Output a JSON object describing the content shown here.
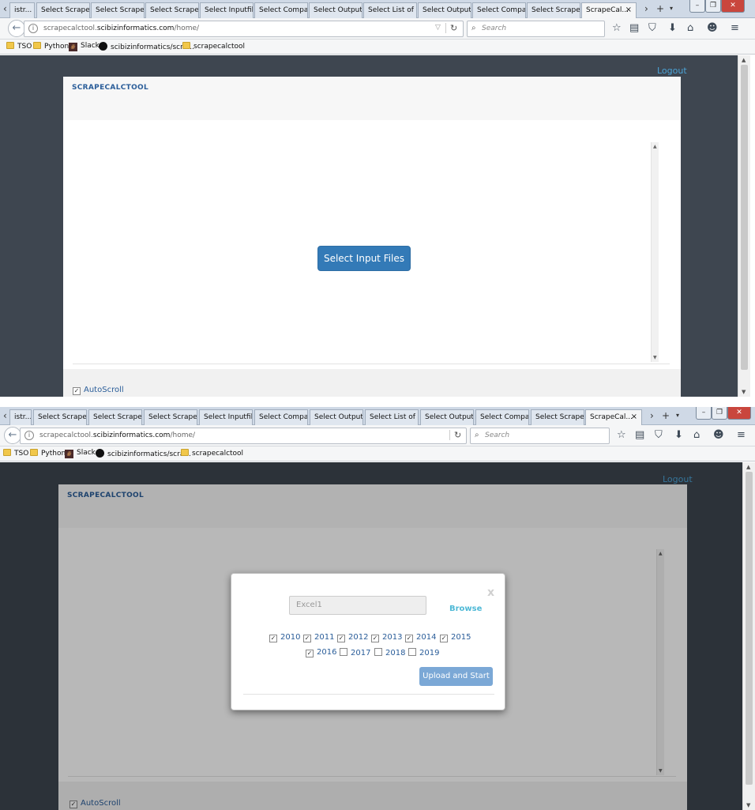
{
  "browser": {
    "tabs": [
      "istr...",
      "Select Scraper...",
      "Select Scraper...",
      "Select Scraper...",
      "Select Inputfil...",
      "Select Compa...",
      "Select Output...",
      "Select List of ...",
      "Select Output...",
      "Select Compa...",
      "Select Scraper...",
      "ScrapeCal..."
    ],
    "active_tab_close": "×",
    "new_tab": "+",
    "url_host_prefix": "scrapecalctool.",
    "url_host_bold": "scibizinformatics.com",
    "url_path": "/home/",
    "search_placeholder": "Search",
    "bookmarks": [
      "TSO",
      "Python",
      "Slack",
      "scibizinformatics/scra...",
      "scrapecalctool"
    ]
  },
  "app": {
    "logout": "Logout",
    "title": "SCRAPECALCTOOL",
    "select_button": "Select Input Files",
    "autoscroll_label": "AutoScroll"
  },
  "modal": {
    "file_name": "Excel1",
    "browse": "Browse",
    "close": "x",
    "upload_button": "Upload and Start",
    "years": [
      {
        "label": "2010",
        "checked": true
      },
      {
        "label": "2011",
        "checked": true
      },
      {
        "label": "2012",
        "checked": true
      },
      {
        "label": "2013",
        "checked": true
      },
      {
        "label": "2014",
        "checked": true
      },
      {
        "label": "2015",
        "checked": true
      },
      {
        "label": "2016",
        "checked": true
      },
      {
        "label": "2017",
        "checked": false
      },
      {
        "label": "2018",
        "checked": false
      },
      {
        "label": "2019",
        "checked": false
      }
    ]
  }
}
